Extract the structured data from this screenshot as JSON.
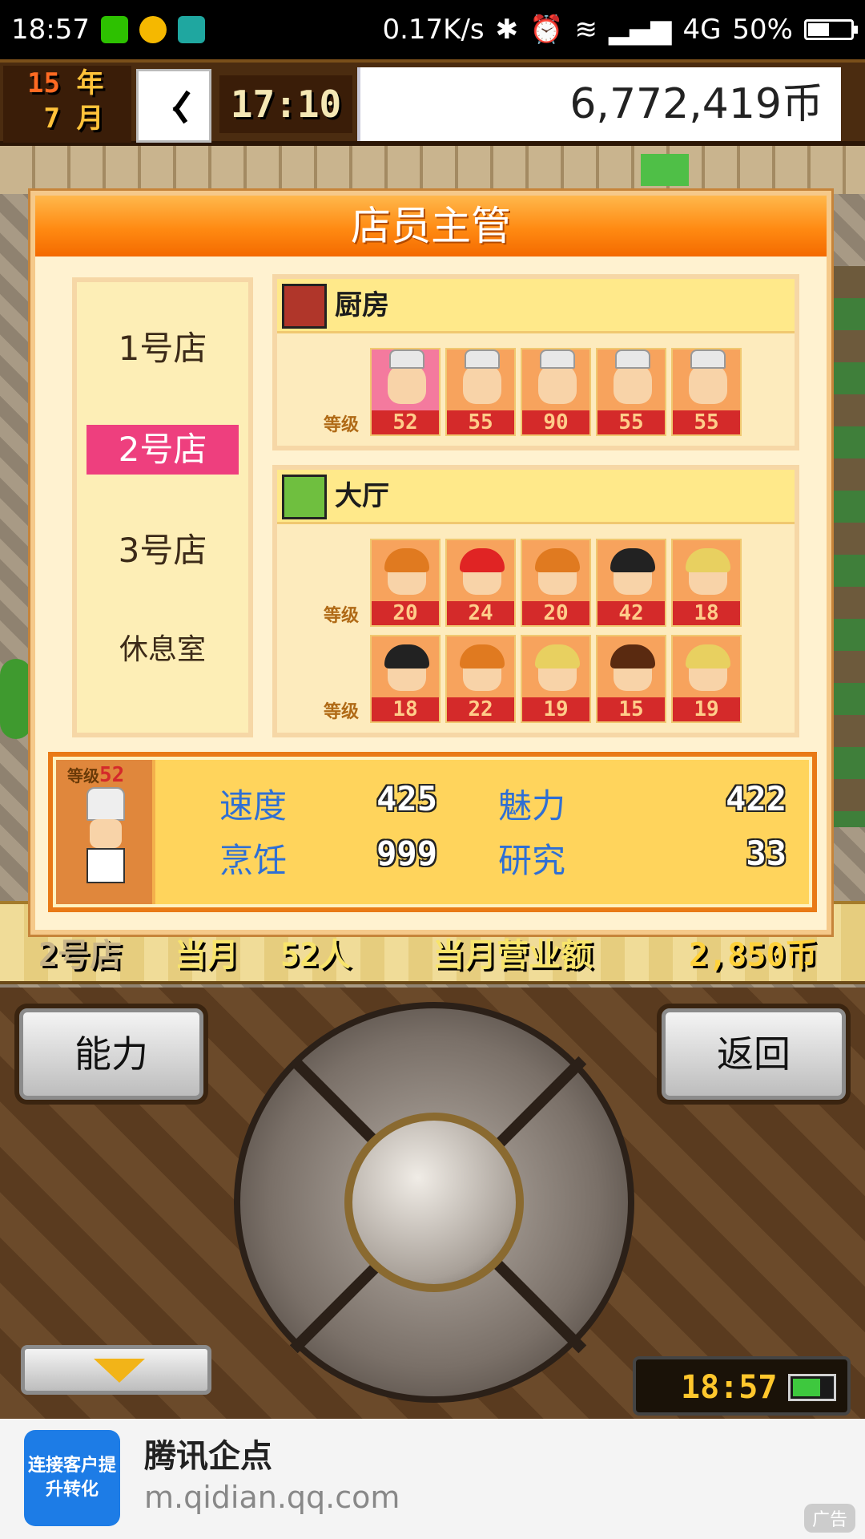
{
  "status_bar": {
    "time": "18:57",
    "net_speed": "0.17K/s",
    "network": "4G",
    "battery": "50%",
    "battery_level": 0.5
  },
  "hud": {
    "year": "15",
    "year_unit": "年",
    "month": "7",
    "month_unit": "月",
    "game_time": "17:10",
    "money": "6,772,419币"
  },
  "dialog": {
    "title": "店员主管",
    "stores": [
      {
        "label": "1号店",
        "active": false
      },
      {
        "label": "2号店",
        "active": true
      },
      {
        "label": "3号店",
        "active": false
      },
      {
        "label": "休息室",
        "active": false
      }
    ],
    "grade_label": "等级",
    "kitchen": {
      "label": "厨房",
      "staff_levels": [
        "52",
        "55",
        "90",
        "55",
        "55"
      ]
    },
    "hall": {
      "label": "大厅",
      "row1_levels": [
        "20",
        "24",
        "20",
        "42",
        "18"
      ],
      "row2_levels": [
        "18",
        "22",
        "19",
        "15",
        "19"
      ]
    },
    "selected": {
      "grade_label": "等级",
      "level": "52",
      "stats": [
        {
          "name": "速度",
          "value": "425"
        },
        {
          "name": "魅力",
          "value": "422"
        },
        {
          "name": "烹饪",
          "value": "999"
        },
        {
          "name": "研究",
          "value": "33"
        }
      ]
    }
  },
  "info_strip": {
    "store": "2号店",
    "month_label": "当月",
    "people": "52人",
    "sales_label": "当月营业额",
    "sales": "2,850币"
  },
  "controls": {
    "ability_label": "能力",
    "back_label": "返回",
    "clock": "18:57"
  },
  "ad": {
    "icon_text": "连接客户提升转化",
    "title": "腾讯企点",
    "url": "m.qidian.qq.com",
    "tag": "广告"
  },
  "colors": {
    "active_store": "#ee3f7e",
    "stat_name": "#2f6fd4",
    "title_orange": "#ff8a12"
  }
}
